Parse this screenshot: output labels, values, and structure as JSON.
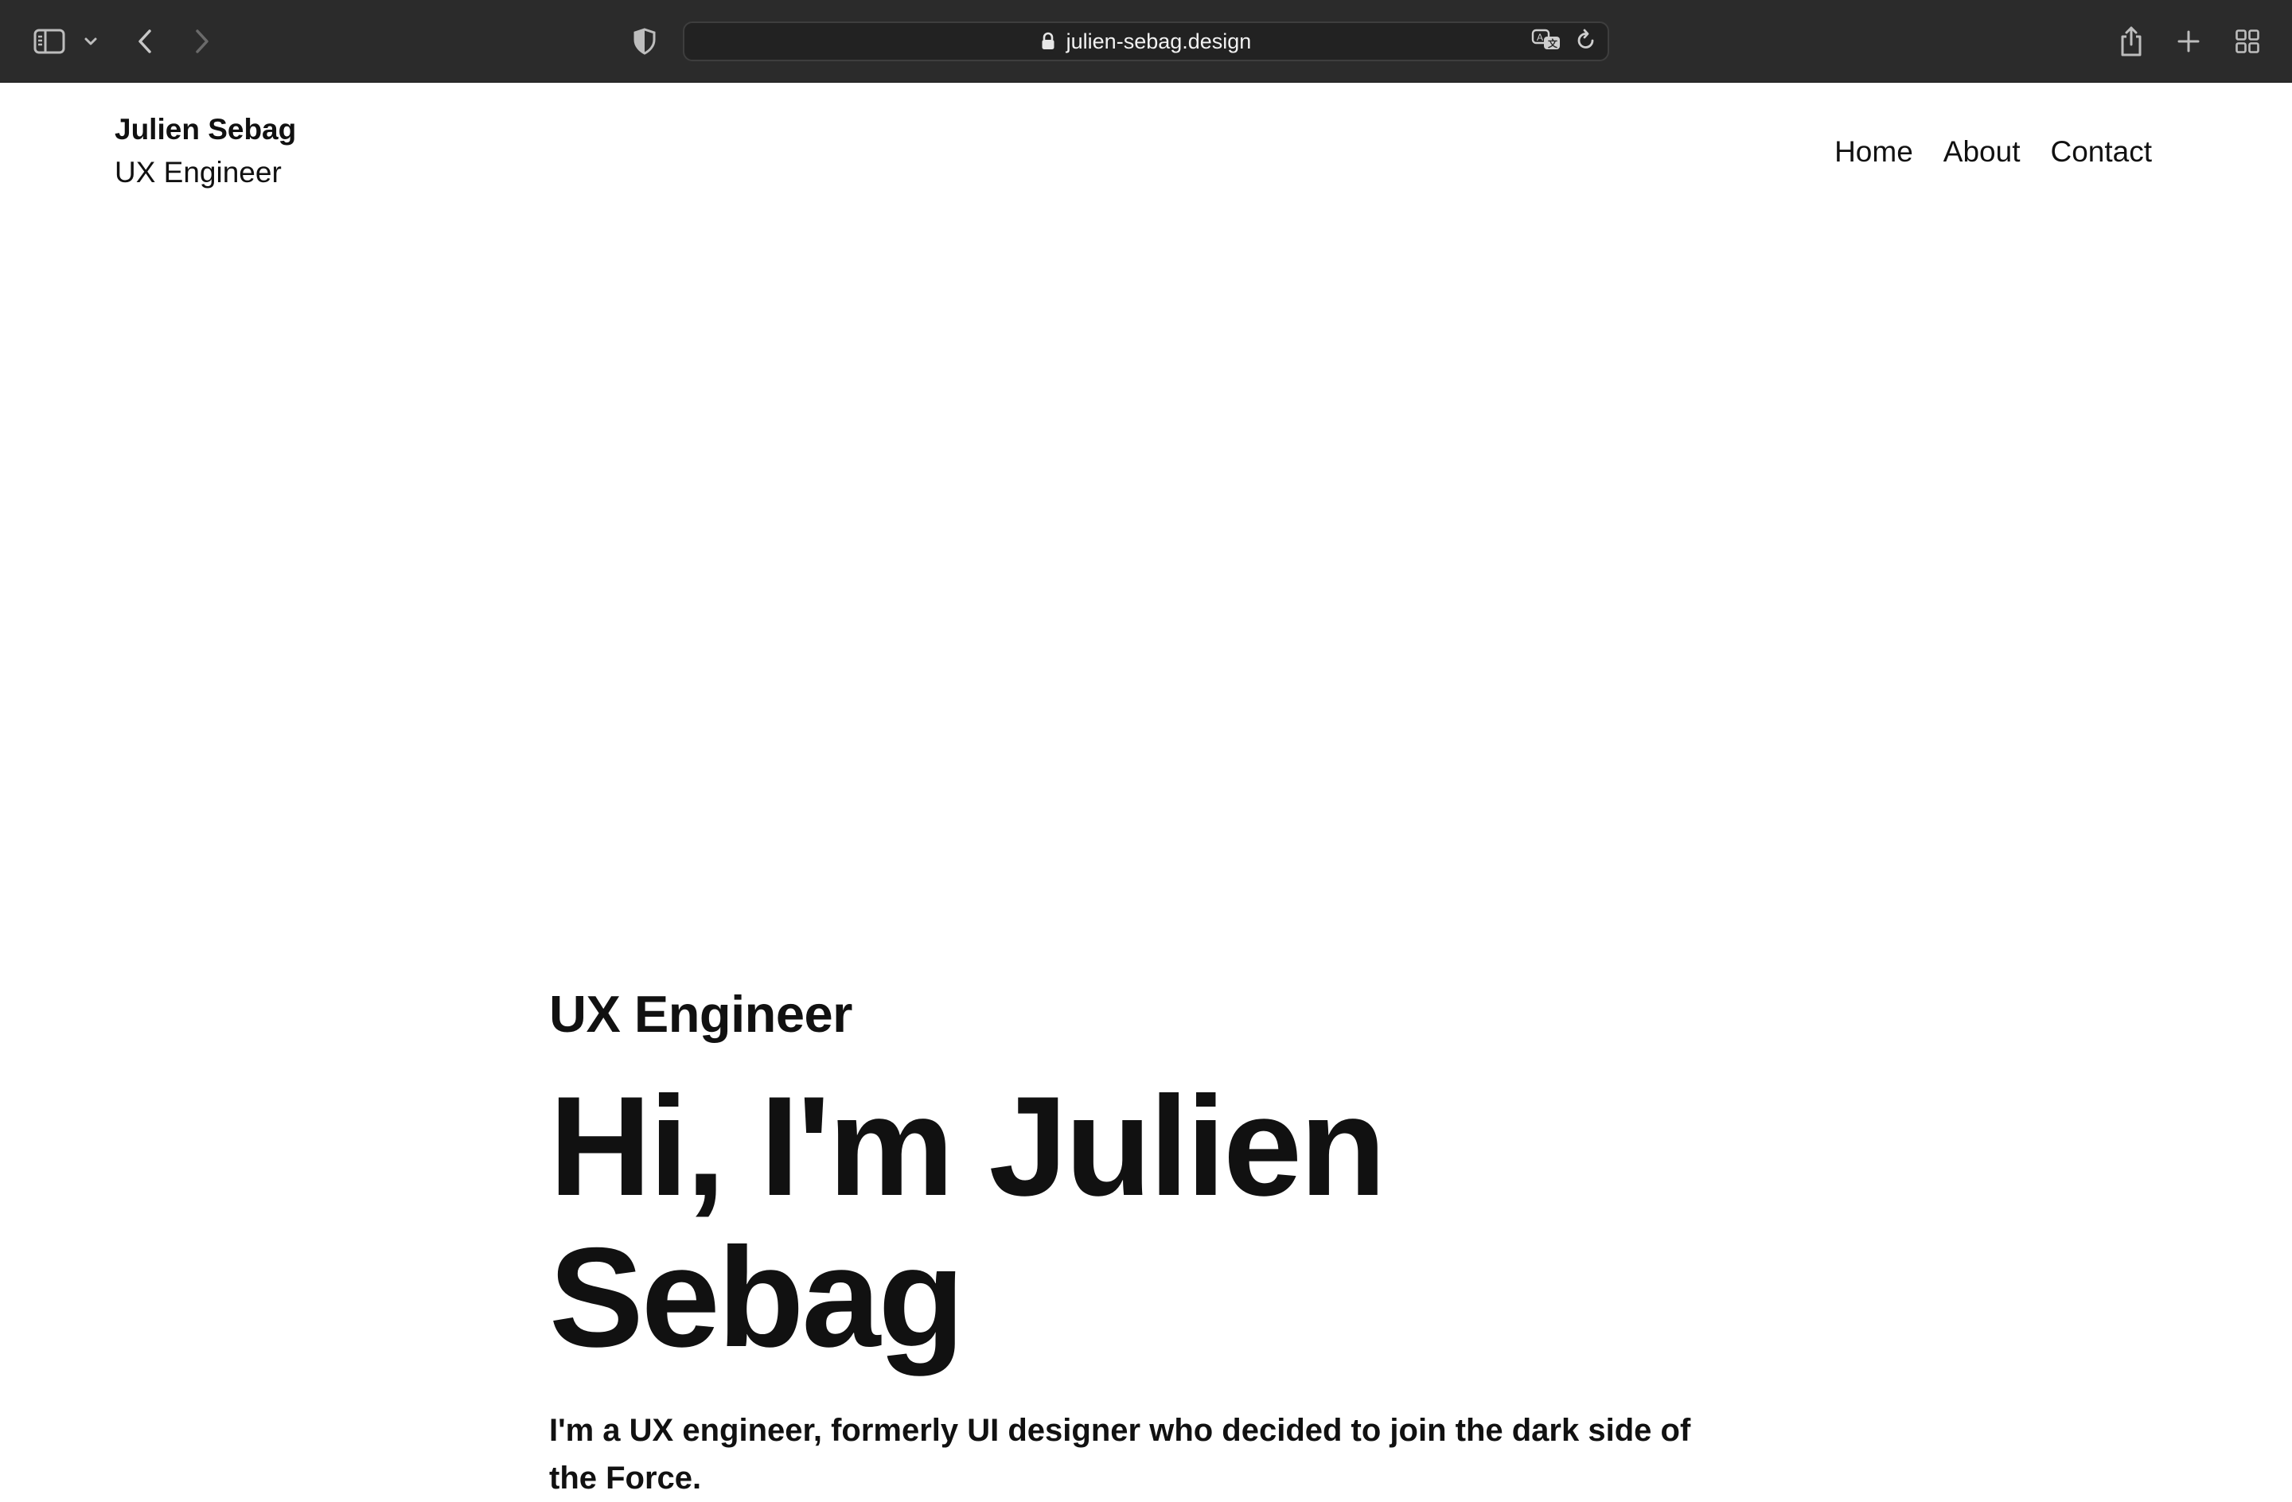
{
  "browser": {
    "url": "julien-sebag.design",
    "icons": {
      "sidebar": "sidebar-icon",
      "tab_group_menu": "chevron-down-icon",
      "back": "chevron-left-icon",
      "forward": "chevron-right-icon",
      "privacy": "shield-icon",
      "lock": "lock-icon",
      "translate": "translate-icon",
      "reload": "reload-icon",
      "share": "share-icon",
      "new_tab": "plus-icon",
      "tab_overview": "grid-icon"
    }
  },
  "header": {
    "brand_name": "Julien Sebag",
    "brand_role": "UX Engineer",
    "nav": [
      {
        "label": "Home"
      },
      {
        "label": "About"
      },
      {
        "label": "Contact"
      }
    ]
  },
  "hero": {
    "kicker": "UX Engineer",
    "title": "Hi, I'm Julien Sebag",
    "description": "I'm a UX engineer, formerly UI designer who decided to join the dark side of the Force."
  },
  "colors": {
    "toolbar": "#2b2b2b",
    "page_background": "#ffffff",
    "text": "#111111"
  }
}
